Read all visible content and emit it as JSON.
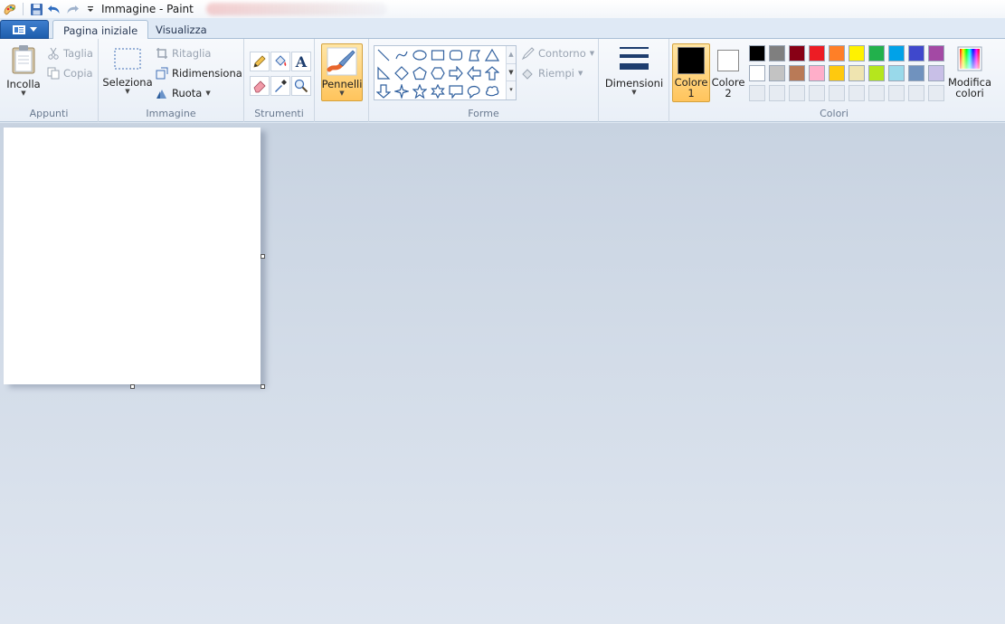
{
  "window": {
    "title": "Immagine - Paint"
  },
  "tabs": [
    {
      "label": "Pagina iniziale",
      "active": true
    },
    {
      "label": "Visualizza",
      "active": false
    }
  ],
  "groups": {
    "clipboard": {
      "label": "Appunti",
      "paste": "Incolla",
      "cut": "Taglia",
      "copy": "Copia"
    },
    "image": {
      "label": "Immagine",
      "select": "Seleziona",
      "crop": "Ritaglia",
      "resize": "Ridimensiona",
      "rotate": "Ruota"
    },
    "tools": {
      "label": "Strumenti"
    },
    "brushes": {
      "label": "Pennelli"
    },
    "shapes": {
      "label": "Forme",
      "outline": "Contorno",
      "fill": "Riempi"
    },
    "size": {
      "label": "Dimensioni"
    },
    "colors": {
      "label": "Colori",
      "color1": "Colore\n1",
      "color1_top": "Colore",
      "color1_num": "1",
      "color2_top": "Colore",
      "color2_num": "2",
      "edit_top": "Modifica",
      "edit_bottom": "colori",
      "color1_value": "#000000",
      "color2_value": "#ffffff",
      "palette_row1": [
        "#000000",
        "#7f7f7f",
        "#880015",
        "#ed1c24",
        "#ff7f27",
        "#fff200",
        "#22b14c",
        "#00a2e8",
        "#3f48cc",
        "#a349a4"
      ],
      "palette_row2": [
        "#ffffff",
        "#c3c3c3",
        "#b97a57",
        "#ffaec9",
        "#ffc90e",
        "#efe4b0",
        "#b5e61d",
        "#99d9ea",
        "#7092be",
        "#c8bfe7"
      ]
    }
  }
}
